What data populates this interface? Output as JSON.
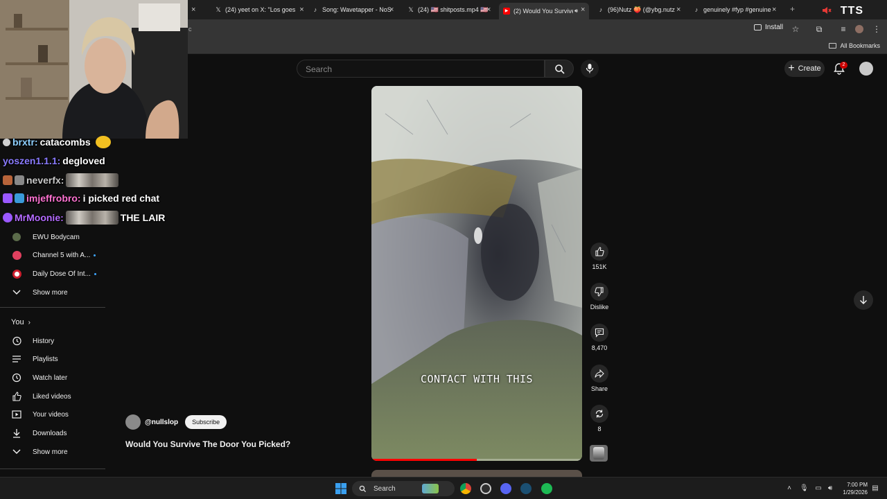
{
  "browser": {
    "tabs": [
      {
        "title": "(24) yeet on X: \"Los goes",
        "icon": "x-logo-icon"
      },
      {
        "title": "Song: Wavetapper - NoS",
        "icon": "tiktok-icon"
      },
      {
        "title": "(24) 🇺🇸 shitposts.mp4 🇺🇸",
        "icon": "x-logo-icon"
      },
      {
        "title": "(2) Would You Survive",
        "icon": "youtube-icon",
        "active": true
      },
      {
        "title": "(96)Nutz 🍑 (@ybg.nutz",
        "icon": "tiktok-icon"
      },
      {
        "title": "genuinely #fyp #genuine",
        "icon": "tiktok-icon"
      }
    ],
    "new_tab": "+",
    "tts_label": "TTS",
    "install_label": "Install",
    "all_bookmarks_label": "All Bookmarks",
    "address_fragment": "c"
  },
  "youtube": {
    "search_placeholder": "Search",
    "create_label": "Create",
    "notification_count": "2",
    "sidebar": {
      "subscriptions": [
        {
          "label": "EWU Bodycam",
          "new": false
        },
        {
          "label": "Channel 5 with A...",
          "new": true
        },
        {
          "label": "Daily Dose Of Int...",
          "new": true
        }
      ],
      "show_more_1": "Show more",
      "you_label": "You",
      "you_items": [
        {
          "label": "History",
          "icon": "history-icon"
        },
        {
          "label": "Playlists",
          "icon": "playlists-icon"
        },
        {
          "label": "Watch later",
          "icon": "watch-later-icon"
        },
        {
          "label": "Liked videos",
          "icon": "liked-videos-icon"
        },
        {
          "label": "Your videos",
          "icon": "your-videos-icon"
        },
        {
          "label": "Downloads",
          "icon": "downloads-icon"
        }
      ],
      "show_more_2": "Show more"
    },
    "short": {
      "caption": "CONTACT WITH THIS",
      "progress_fraction": 0.5,
      "likes": "151K",
      "dislike_label": "Dislike",
      "comments": "8,470",
      "share_label": "Share",
      "remix_count": "8",
      "channel": "@nullslop",
      "subscribe_label": "Subscribe",
      "title": "Would You Survive The Door You Picked?"
    }
  },
  "chat": [
    {
      "user": "brxtr:",
      "msg": "catacombs",
      "color": "#8fd0ff",
      "emote": false
    },
    {
      "user": "yoszen1.1.1:",
      "msg": "degloved",
      "color": "#8a7bff",
      "emote": false
    },
    {
      "user": "neverfx:",
      "msg": "",
      "color": "#c8c8c8",
      "emote": true
    },
    {
      "user": "imjeffrobro:",
      "msg": "i picked red chat",
      "color": "#ff73d2",
      "emote": false
    },
    {
      "user": "MrMoonie:",
      "msg": "THE LAIR",
      "color": "#b46bff",
      "emote": true
    }
  ],
  "taskbar": {
    "search_label": "Search",
    "time": "7:00 PM",
    "date": "1/29/2026"
  },
  "colors": {
    "youtube_bg": "#0f0f0f",
    "progress_red": "#ff0000",
    "notification_red": "#cc0000",
    "browser_tab_bg": "#1f1f1f"
  }
}
